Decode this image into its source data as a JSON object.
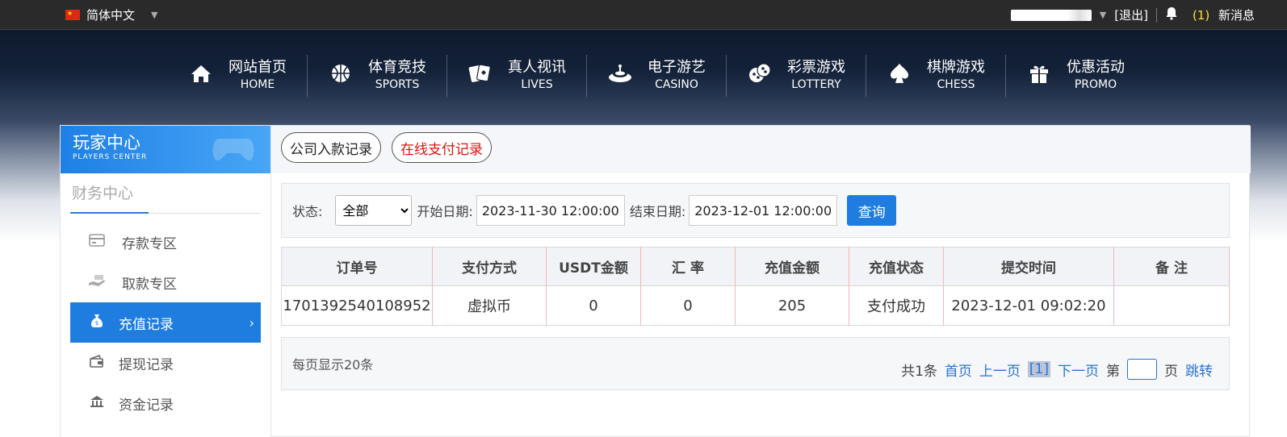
{
  "topbar": {
    "language": "简体中文",
    "logout": "[退出]",
    "messages_count": "(1)",
    "messages_label": "新消息"
  },
  "nav": [
    {
      "cn": "网站首页",
      "en": "HOME",
      "icon": "home-icon"
    },
    {
      "cn": "体育竞技",
      "en": "SPORTS",
      "icon": "basketball-icon"
    },
    {
      "cn": "真人视讯",
      "en": "LIVES",
      "icon": "cards-icon"
    },
    {
      "cn": "电子游艺",
      "en": "CASINO",
      "icon": "roulette-icon"
    },
    {
      "cn": "彩票游戏",
      "en": "LOTTERY",
      "icon": "dice-icon"
    },
    {
      "cn": "棋牌游戏",
      "en": "CHESS",
      "icon": "spade-icon"
    },
    {
      "cn": "优惠活动",
      "en": "PROMO",
      "icon": "gift-icon"
    }
  ],
  "sidebar": {
    "title": "玩家中心",
    "subtitle": "PLAYERS CENTER",
    "section": "财务中心",
    "items": [
      {
        "label": "存款专区"
      },
      {
        "label": "取款专区"
      },
      {
        "label": "充值记录"
      },
      {
        "label": "提现记录"
      },
      {
        "label": "资金记录"
      }
    ]
  },
  "tabs": {
    "company": "公司入款记录",
    "online": "在线支付记录"
  },
  "filter": {
    "status_label": "状态:",
    "status_value": "全部",
    "start_label": "开始日期:",
    "start_value": "2023-11-30 12:00:00",
    "end_label": "结束日期:",
    "end_value": "2023-12-01 12:00:00",
    "query": "查询"
  },
  "table": {
    "headers": [
      "订单号",
      "支付方式",
      "USDT金额",
      "汇 率",
      "充值金额",
      "充值状态",
      "提交时间",
      "备 注"
    ],
    "rows": [
      [
        "1701392540108952",
        "虚拟币",
        "0",
        "0",
        "205",
        "支付成功",
        "2023-12-01 09:02:20",
        ""
      ]
    ]
  },
  "pager": {
    "per_page": "每页显示20条",
    "total": "共1条",
    "first": "首页",
    "prev": "上一页",
    "current": "[1]",
    "next": "下一页",
    "page_prefix": "第",
    "page_suffix": "页",
    "jump": "跳转"
  },
  "colors": {
    "accent": "#1f7de0",
    "danger_text": "#e01010",
    "link": "#2a73d0"
  }
}
